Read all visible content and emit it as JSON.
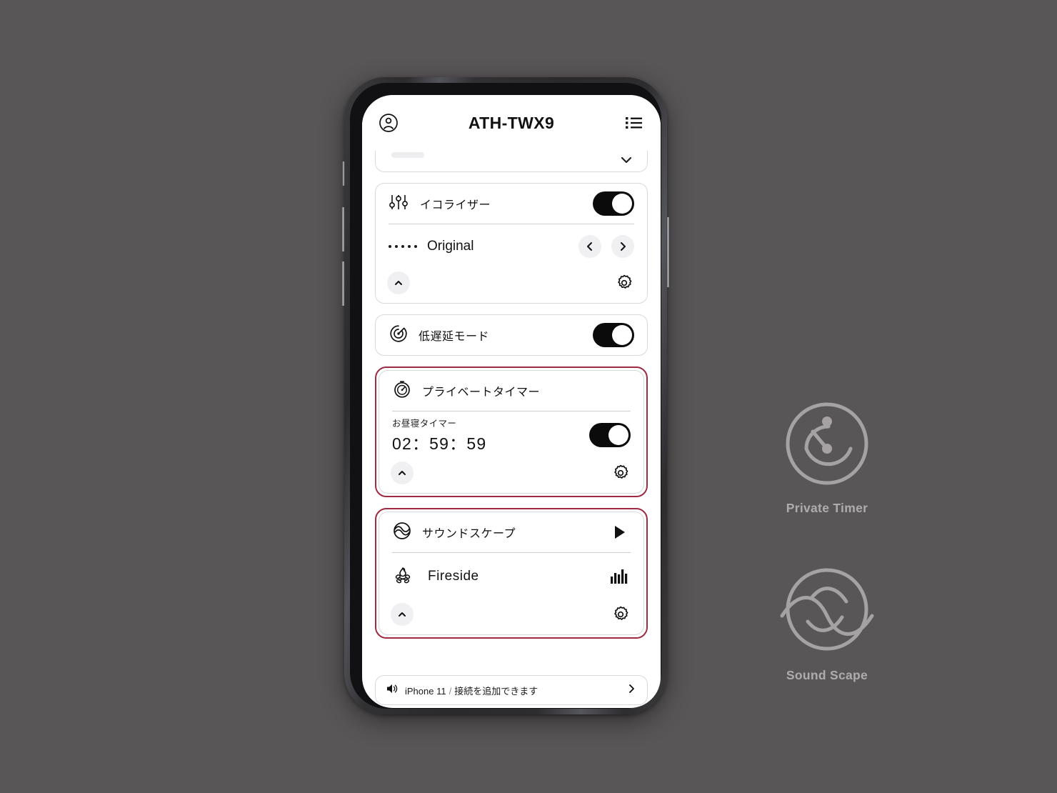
{
  "background_color": "#595657",
  "highlight_color": "#9e2b42",
  "phone": {
    "header": {
      "title": "ATH-TWX9",
      "account_icon": "account-circle-icon",
      "menu_icon": "list-menu-icon"
    },
    "cards": {
      "partial_top": {
        "collapse_icon": "chevron-down-icon"
      },
      "equalizer": {
        "icon": "equalizer-sliders-icon",
        "label": "イコライザー",
        "toggle_state": "on",
        "preset_name": "Original",
        "prev_icon": "chevron-left-icon",
        "next_icon": "chevron-right-icon",
        "collapse_icon": "chevron-up-icon",
        "settings_icon": "gear-icon"
      },
      "low_latency": {
        "icon": "speedometer-icon",
        "label": "低遅延モード",
        "toggle_state": "on"
      },
      "private_timer": {
        "icon": "stopwatch-icon",
        "label": "プライベートタイマー",
        "timer_label": "お昼寝タイマー",
        "timer_value": "02：59：59",
        "toggle_state": "on",
        "collapse_icon": "chevron-up-icon",
        "settings_icon": "gear-icon",
        "highlighted": true
      },
      "sound_scape": {
        "icon": "sound-scape-waves-icon",
        "label": "サウンドスケープ",
        "play_icon": "play-icon",
        "track_icon": "campfire-icon",
        "track_name": "Fireside",
        "level_icon": "sound-bars-icon",
        "collapse_icon": "chevron-up-icon",
        "settings_icon": "gear-icon",
        "highlighted": true
      }
    },
    "bottom_bar": {
      "icon": "speaker-output-icon",
      "device_name": "iPhone 11",
      "separator": "/",
      "hint": "接続を追加できます",
      "expand_icon": "chevron-right-icon"
    }
  },
  "annotations": [
    {
      "icon": "private-timer-clock-icon",
      "label": "Private Timer"
    },
    {
      "icon": "sound-scape-waves-icon",
      "label": "Sound Scape"
    }
  ]
}
